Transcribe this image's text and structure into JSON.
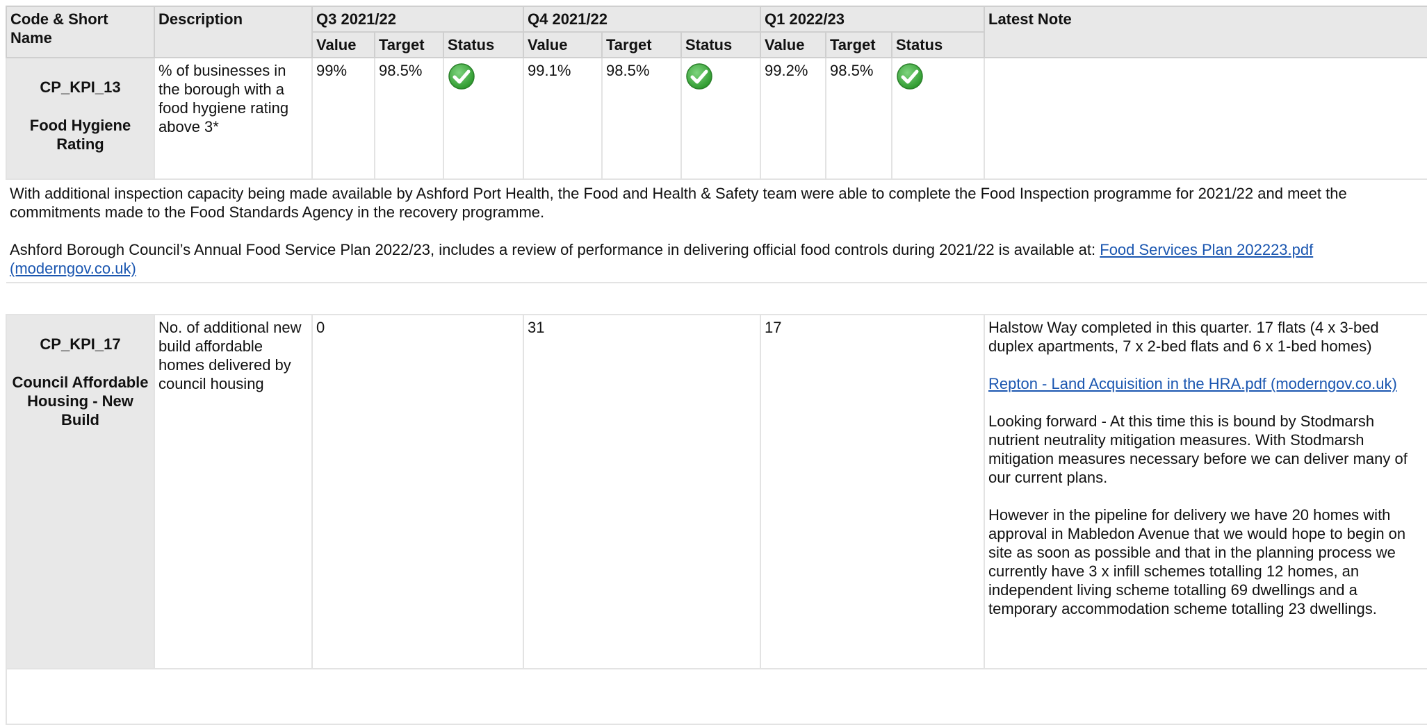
{
  "headers": {
    "code": "Code & Short Name",
    "description": "Description",
    "note": "Latest Note",
    "periods": [
      "Q3 2021/22",
      "Q4 2021/22",
      "Q1 2022/23"
    ],
    "value": "Value",
    "target": "Target",
    "status": "Status"
  },
  "kpi13": {
    "code": "CP_KPI_13",
    "name": "Food Hygiene Rating",
    "description": "% of businesses in the borough with a food hygiene rating above 3*",
    "q3": {
      "value": "99%",
      "target": "98.5%",
      "status": "on-target-check-icon"
    },
    "q4": {
      "value": "99.1%",
      "target": "98.5%",
      "status": "on-target-check-icon"
    },
    "q1": {
      "value": "99.2%",
      "target": "98.5%",
      "status": "on-target-check-icon"
    },
    "comment_1": "With additional inspection capacity being made available by Ashford Port Health, the Food and Health & Safety team were able to complete the Food Inspection programme for 2021/22 and meet the commitments made to the Food Standards Agency in the recovery programme.",
    "comment_2": "Ashford Borough Council’s Annual Food Service Plan 2022/23, includes a review of performance in delivering official food controls during 2021/22 is available at: ",
    "comment_link": "Food Services Plan 202223.pdf (moderngov.co.uk)"
  },
  "kpi17": {
    "code": "CP_KPI_17",
    "name": "Council Affordable Housing - New Build",
    "description": "No. of additional new build affordable homes delivered by council housing",
    "q3_value": "0",
    "q4_value": "31",
    "q1_value": "17",
    "note_1": "Halstow Way completed in this quarter. 17 flats (4 x 3-bed duplex apartments, 7 x 2-bed flats and 6 x 1-bed homes)",
    "note_link": "Repton - Land Acquisition in the HRA.pdf (moderngov.co.uk)",
    "note_2": "Looking forward - At this time this is bound by Stodmarsh nutrient neutrality mitigation measures. With Stodmarsh mitigation measures necessary before we can deliver many of our current plans.",
    "note_3": "However in the pipeline for delivery we have 20 homes with approval in Mabledon Avenue that we would hope to begin on site as soon as possible and that in the planning process we currently have 3 x infill schemes totalling 12 homes, an independent living scheme totalling 69 dwellings and a temporary accommodation scheme totalling 23 dwellings."
  },
  "colors": {
    "header_bg": "#e8e8e8",
    "link": "#1a56b0",
    "status_green": "#3aa63a"
  }
}
